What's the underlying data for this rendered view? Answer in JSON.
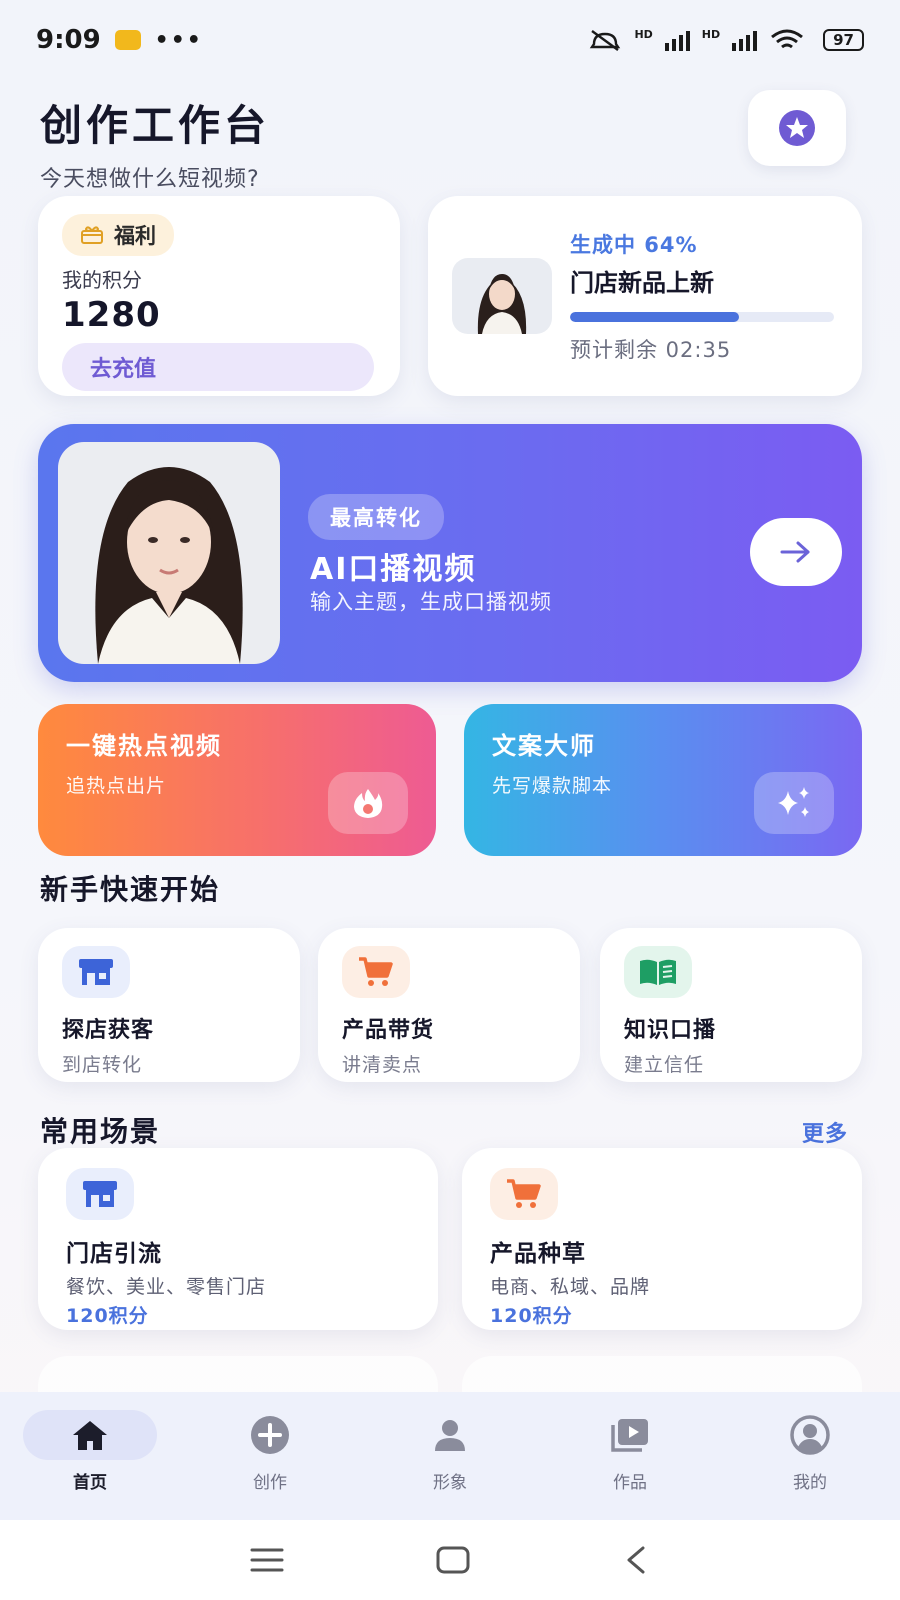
{
  "status_bar": {
    "time": "9:09",
    "more": "•••",
    "battery": "97",
    "hd_1": "HD",
    "hd_2": "HD"
  },
  "header": {
    "title": "创作工作台",
    "subtitle": "今天想做什么短视频?"
  },
  "points_card": {
    "badge": "福利",
    "label": "我的积分",
    "value": "1280",
    "button": "去充值"
  },
  "progress_card": {
    "status": "生成中 64%",
    "title": "门店新品上新",
    "progress": 0.64,
    "eta": "预计剩余 02:35"
  },
  "hero": {
    "tag": "最高转化",
    "title": "AI口播视频",
    "description": "输入主题，生成口播视频"
  },
  "features": [
    {
      "title": "一键热点视频",
      "description": "追热点出片",
      "icon": "flame-icon"
    },
    {
      "title": "文案大师",
      "description": "先写爆款脚本",
      "icon": "sparkles-icon"
    }
  ],
  "quick_start": {
    "title": "新手快速开始",
    "items": [
      {
        "title": "探店获客",
        "description": "到店转化",
        "icon": "store-icon"
      },
      {
        "title": "产品带货",
        "description": "讲清卖点",
        "icon": "cart-icon"
      },
      {
        "title": "知识口播",
        "description": "建立信任",
        "icon": "book-icon"
      }
    ]
  },
  "scenes": {
    "title": "常用场景",
    "more": "更多",
    "items": [
      {
        "title": "门店引流",
        "description": "餐饮、美业、零售门店",
        "cost": "120积分",
        "icon": "store-icon"
      },
      {
        "title": "产品种草",
        "description": "电商、私域、品牌",
        "cost": "120积分",
        "icon": "cart-icon"
      }
    ]
  },
  "tabs": [
    {
      "label": "首页",
      "icon": "home-icon",
      "active": true
    },
    {
      "label": "创作",
      "icon": "plus-circle-icon",
      "active": false
    },
    {
      "label": "形象",
      "icon": "person-icon",
      "active": false
    },
    {
      "label": "作品",
      "icon": "video-library-icon",
      "active": false
    },
    {
      "label": "我的",
      "icon": "profile-icon",
      "active": false
    }
  ],
  "colors": {
    "accent": "#4a72dd",
    "purple": "#6f5bd3",
    "hero_start": "#5a76ee",
    "hero_end": "#7b5cf2"
  }
}
